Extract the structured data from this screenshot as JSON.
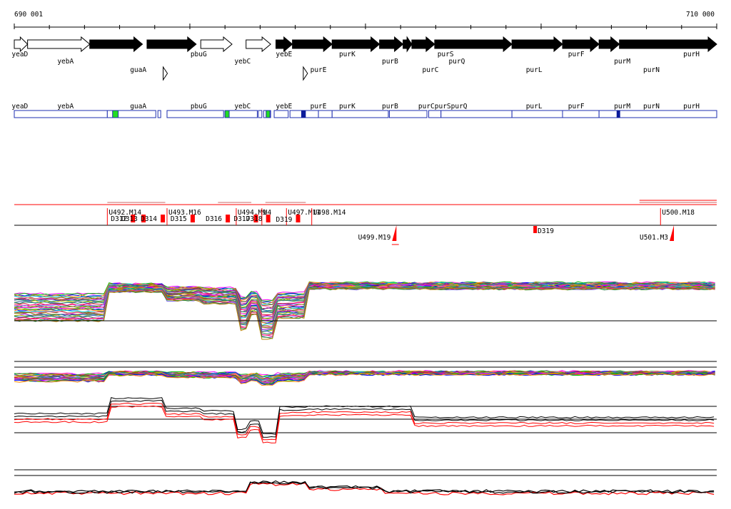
{
  "chart_data": {
    "type": "line",
    "ruler": {
      "start_label": "690 001",
      "end_label": "710 000",
      "start": 690001,
      "end": 710000
    },
    "genes": [
      {
        "name": "yeaD",
        "start": 690001,
        "end": 690380,
        "strand": "+",
        "style": "open",
        "row": "top"
      },
      {
        "name": "yebA",
        "start": 690380,
        "end": 692150,
        "strand": "+",
        "style": "open",
        "row": "top"
      },
      {
        "name": "guaA",
        "start": 692150,
        "end": 693650,
        "strand": "+",
        "style": "filled",
        "row": "top"
      },
      {
        "name": "pbuG",
        "start": 693780,
        "end": 695180,
        "strand": "+",
        "style": "filled",
        "row": "top"
      },
      {
        "name": "yebC",
        "start": 695310,
        "end": 696200,
        "strand": "+",
        "style": "open",
        "row": "top"
      },
      {
        "name": "yebE",
        "start": 696600,
        "end": 697300,
        "strand": "+",
        "style": "open",
        "row": "top"
      },
      {
        "name": "purE",
        "start": 697450,
        "end": 697920,
        "strand": "+",
        "style": "filled",
        "row": "top"
      },
      {
        "name": "purK",
        "start": 697920,
        "end": 699050,
        "strand": "+",
        "style": "filled",
        "row": "top"
      },
      {
        "name": "purB",
        "start": 699050,
        "end": 700400,
        "strand": "+",
        "style": "filled",
        "row": "top"
      },
      {
        "name": "purC",
        "start": 700400,
        "end": 701070,
        "strand": "+",
        "style": "filled",
        "row": "top"
      },
      {
        "name": "purS",
        "start": 701070,
        "end": 701320,
        "strand": "+",
        "style": "filled",
        "row": "top"
      },
      {
        "name": "purQ",
        "start": 701320,
        "end": 701970,
        "strand": "+",
        "style": "filled",
        "row": "top"
      },
      {
        "name": "purL",
        "start": 701970,
        "end": 704170,
        "strand": "+",
        "style": "filled",
        "row": "top"
      },
      {
        "name": "purF",
        "start": 704170,
        "end": 705610,
        "strand": "+",
        "style": "filled",
        "row": "top"
      },
      {
        "name": "purM",
        "start": 705610,
        "end": 706650,
        "strand": "+",
        "style": "filled",
        "row": "top"
      },
      {
        "name": "purN",
        "start": 706650,
        "end": 707230,
        "strand": "+",
        "style": "filled",
        "row": "top"
      },
      {
        "name": "purH",
        "start": 707230,
        "end": 710000,
        "strand": "+",
        "style": "filled",
        "row": "top"
      }
    ],
    "gene_labels": [
      {
        "text": "yeaD",
        "pos": 690160,
        "line": 1
      },
      {
        "text": "yebA",
        "pos": 691460,
        "line": 2
      },
      {
        "text": "guaA",
        "pos": 693530,
        "line": 3
      },
      {
        "text": "pbuG",
        "pos": 695250,
        "line": 1
      },
      {
        "text": "yebC",
        "pos": 696500,
        "line": 2
      },
      {
        "text": "yebE",
        "pos": 697680,
        "line": 1
      },
      {
        "text": "purE",
        "pos": 698660,
        "line": 3
      },
      {
        "text": "purK",
        "pos": 699480,
        "line": 1
      },
      {
        "text": "purB",
        "pos": 700700,
        "line": 2
      },
      {
        "text": "purC",
        "pos": 701850,
        "line": 3
      },
      {
        "text": "purS",
        "pos": 702280,
        "line": 1
      },
      {
        "text": "purQ",
        "pos": 702600,
        "line": 2
      },
      {
        "text": "purL",
        "pos": 704800,
        "line": 3
      },
      {
        "text": "purF",
        "pos": 706000,
        "line": 1
      },
      {
        "text": "purM",
        "pos": 707310,
        "line": 2
      },
      {
        "text": "purN",
        "pos": 708140,
        "line": 3
      },
      {
        "text": "purH",
        "pos": 709280,
        "line": 1
      }
    ],
    "extra_markers": [
      {
        "pos": 694300,
        "type": "open-small-arrow"
      },
      {
        "pos": 698290,
        "type": "open-small-arrow"
      }
    ],
    "annotation_track_labels": [
      "yeaD",
      "yebA",
      "guaA",
      "pbuG",
      "yebC",
      "yebE",
      "purE",
      "purK",
      "purB",
      "purCpurSpurQ",
      "purL",
      "purF",
      "purM",
      "purN",
      "purH"
    ],
    "transcription_units": [
      {
        "label": "U492.M14",
        "pos": 692650
      },
      {
        "label": "U493.M16",
        "pos": 694350
      },
      {
        "label": "U494.M9",
        "pos": 696320
      },
      {
        "label": "U4",
        "pos": 697050
      },
      {
        "label": "U497.M11",
        "pos": 697750
      },
      {
        "label": "U498.M14",
        "pos": 698470
      },
      {
        "label": "U499.M19",
        "pos": 700800
      },
      {
        "label": "U500.M18",
        "pos": 708400
      },
      {
        "label": "U501.M3",
        "pos": 708700
      }
    ],
    "downshift_labels": [
      "D312",
      "D313",
      "D314",
      "D315",
      "D316",
      "D317",
      "D318",
      "D319"
    ],
    "tracks": [
      {
        "name": "expression-profiles",
        "kind": "multi-line"
      },
      {
        "name": "antisense-profiles",
        "kind": "multi-line"
      },
      {
        "name": "condition-summary",
        "kind": "black-red-lines"
      },
      {
        "name": "bottom-summary",
        "kind": "black-red-lines"
      }
    ],
    "colors": {
      "gene_fill": "#000000",
      "annotation_border": "#1f2fb0",
      "annotation_green": "#22dd22",
      "annotation_dark": "#0a1a9a",
      "breakpoint_red": "#ff0000",
      "profile_palette": [
        "#ff00ff",
        "#00c000",
        "#0000ff",
        "#ff8c00",
        "#00cccc",
        "#8b4513",
        "#ff69b4",
        "#808000",
        "#9400d3",
        "#008080",
        "#cccc00",
        "#4169e1",
        "#2e8b57",
        "#dc143c",
        "#ff1493",
        "#7b68ee",
        "#228b22",
        "#b8860b"
      ]
    }
  }
}
